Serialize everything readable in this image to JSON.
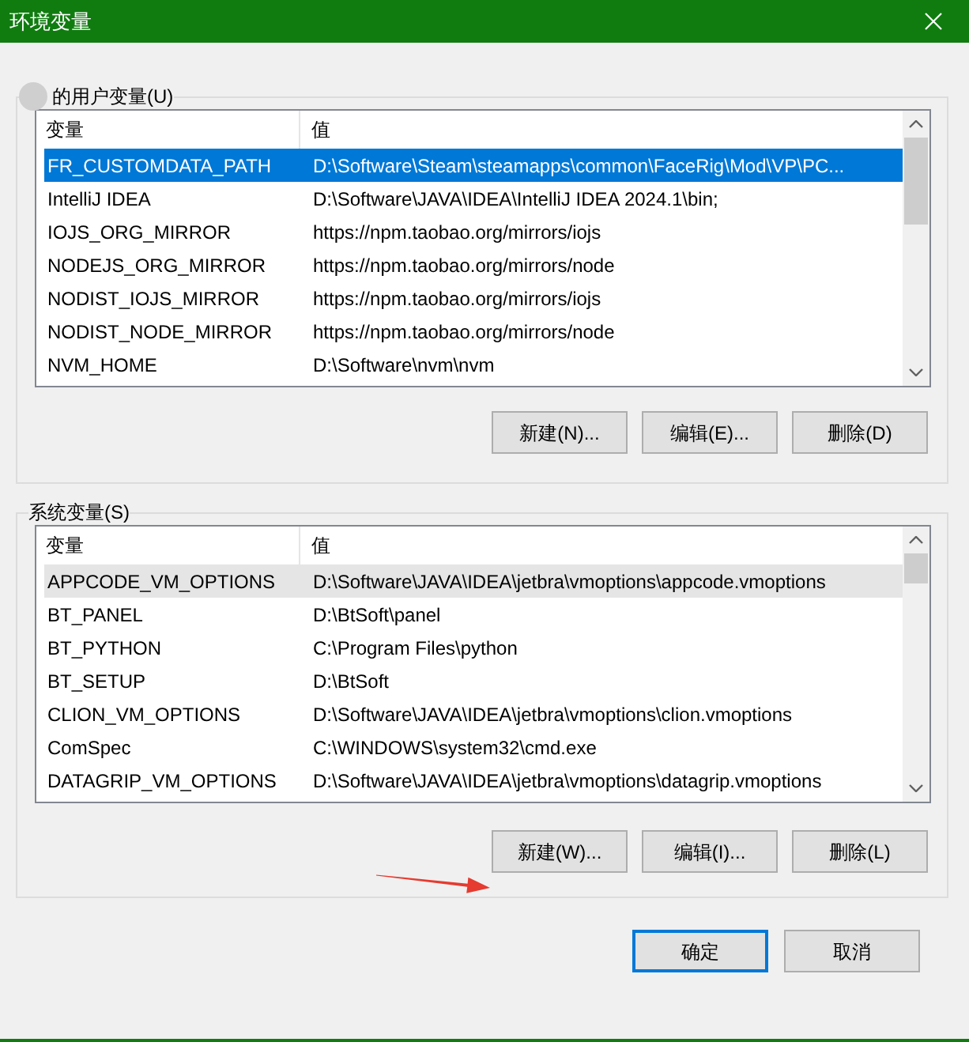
{
  "window": {
    "title": "环境变量"
  },
  "user_variables": {
    "label": "的用户变量(U)",
    "focused": true,
    "columns": [
      "变量",
      "值"
    ],
    "rows": [
      {
        "name": "FR_CUSTOMDATA_PATH",
        "value": "D:\\Software\\Steam\\steamapps\\common\\FaceRig\\Mod\\VP\\PC...",
        "selected": true
      },
      {
        "name": "IntelliJ IDEA",
        "value": "D:\\Software\\JAVA\\IDEA\\IntelliJ IDEA 2024.1\\bin;",
        "selected": false
      },
      {
        "name": "IOJS_ORG_MIRROR",
        "value": "https://npm.taobao.org/mirrors/iojs",
        "selected": false
      },
      {
        "name": "NODEJS_ORG_MIRROR",
        "value": "https://npm.taobao.org/mirrors/node",
        "selected": false
      },
      {
        "name": "NODIST_IOJS_MIRROR",
        "value": "https://npm.taobao.org/mirrors/iojs",
        "selected": false
      },
      {
        "name": "NODIST_NODE_MIRROR",
        "value": "https://npm.taobao.org/mirrors/node",
        "selected": false
      },
      {
        "name": "NVM_HOME",
        "value": "D:\\Software\\nvm\\nvm",
        "selected": false
      }
    ],
    "buttons": [
      "新建(N)...",
      "编辑(E)...",
      "删除(D)"
    ]
  },
  "system_variables": {
    "label": "系统变量(S)",
    "focused": false,
    "columns": [
      "变量",
      "值"
    ],
    "rows": [
      {
        "name": "APPCODE_VM_OPTIONS",
        "value": "D:\\Software\\JAVA\\IDEA\\jetbra\\vmoptions\\appcode.vmoptions",
        "selected": true
      },
      {
        "name": "BT_PANEL",
        "value": "D:\\BtSoft\\panel",
        "selected": false
      },
      {
        "name": "BT_PYTHON",
        "value": "C:\\Program Files\\python",
        "selected": false
      },
      {
        "name": "BT_SETUP",
        "value": "D:\\BtSoft",
        "selected": false
      },
      {
        "name": "CLION_VM_OPTIONS",
        "value": "D:\\Software\\JAVA\\IDEA\\jetbra\\vmoptions\\clion.vmoptions",
        "selected": false
      },
      {
        "name": "ComSpec",
        "value": "C:\\WINDOWS\\system32\\cmd.exe",
        "selected": false
      },
      {
        "name": "DATAGRIP_VM_OPTIONS",
        "value": "D:\\Software\\JAVA\\IDEA\\jetbra\\vmoptions\\datagrip.vmoptions",
        "selected": false
      }
    ],
    "buttons": [
      "新建(W)...",
      "编辑(I)...",
      "删除(L)"
    ]
  },
  "dialog_buttons": [
    {
      "label": "确定",
      "default": true
    },
    {
      "label": "取消",
      "default": false
    }
  ]
}
